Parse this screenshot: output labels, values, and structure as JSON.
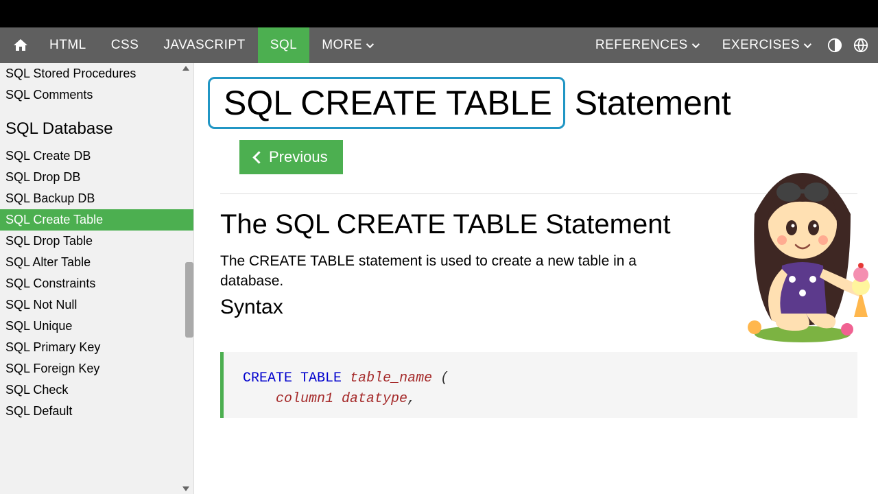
{
  "topnav": {
    "items": [
      "HTML",
      "CSS",
      "JAVASCRIPT",
      "SQL",
      "MORE"
    ],
    "active": "SQL",
    "right_items": [
      "REFERENCES",
      "EXERCISES"
    ]
  },
  "sidebar": {
    "partial_top": [
      "SQL Stored Procedures",
      "SQL Comments"
    ],
    "heading": "SQL Database",
    "items": [
      "SQL Create DB",
      "SQL Drop DB",
      "SQL Backup DB",
      "SQL Create Table",
      "SQL Drop Table",
      "SQL Alter Table",
      "SQL Constraints",
      "SQL Not Null",
      "SQL Unique",
      "SQL Primary Key",
      "SQL Foreign Key",
      "SQL Check",
      "SQL Default"
    ],
    "active": "SQL Create Table"
  },
  "page": {
    "title_boxed": "SQL CREATE TABLE",
    "title_rest": " Statement",
    "prev_label": "Previous",
    "section_heading": "The SQL CREATE TABLE Statement",
    "description": "The CREATE TABLE statement is used to create a new table in a database.",
    "syntax_label": "Syntax",
    "code": {
      "kw1": "CREATE",
      "kw2": "TABLE",
      "tname": "table_name",
      "paren": " (",
      "line2_indent": "    ",
      "col1": "column1 datatype",
      "comma": ","
    }
  }
}
